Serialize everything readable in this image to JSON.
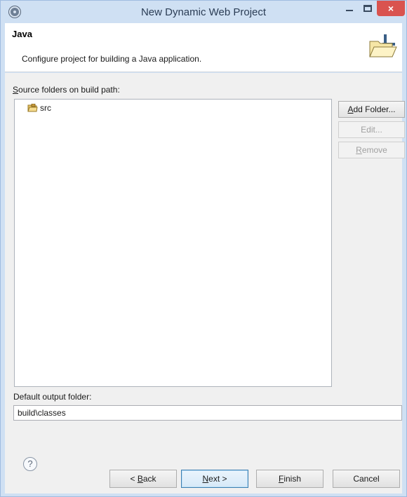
{
  "window": {
    "title": "New Dynamic Web Project",
    "close_glyph": "×"
  },
  "header": {
    "title": "Java",
    "description": "Configure project for building a Java application.",
    "banner_icon": "folder-wizard-icon"
  },
  "source": {
    "label_underlined": "S",
    "label_rest": "ource folders on build path:",
    "items": [
      {
        "label": "src",
        "icon": "package-folder-icon"
      }
    ]
  },
  "buttons": {
    "add_folder_u": "A",
    "add_folder_rest": "dd Folder...",
    "edit": "Edit...",
    "remove_u": "R",
    "remove_rest": "emove"
  },
  "output": {
    "label": "Default output folder:",
    "value": "build\\classes"
  },
  "footer": {
    "help_glyph": "?",
    "back_pre": "< ",
    "back_u": "B",
    "back_rest": "ack",
    "next_u": "N",
    "next_rest": "ext >",
    "finish_u": "F",
    "finish_rest": "inish",
    "cancel": "Cancel"
  }
}
